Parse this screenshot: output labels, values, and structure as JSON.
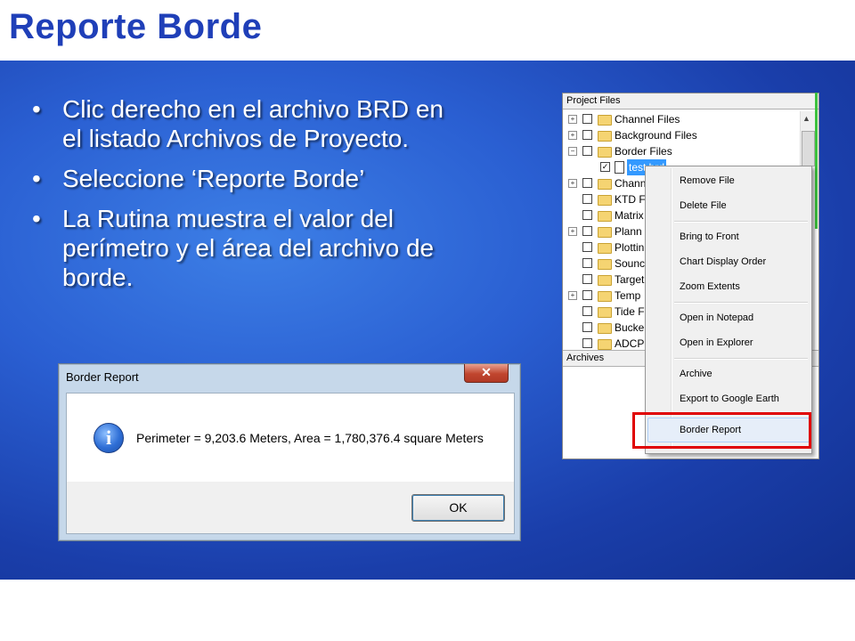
{
  "slide": {
    "title": "Reporte Borde",
    "bullets": [
      "Clic derecho en el archivo BRD en el listado Archivos de Proyecto.",
      "Seleccione  ‘Reporte Borde’",
      "La Rutina muestra el valor del perímetro y el área del archivo de borde."
    ]
  },
  "project_panel": {
    "header": "Project Files",
    "archives_header": "Archives",
    "tree": [
      {
        "label": "Channel Files",
        "icon": "folder-icon",
        "expander": "+"
      },
      {
        "label": "Background Files",
        "icon": "folder-icon",
        "expander": "+"
      },
      {
        "label": "Border Files",
        "icon": "folder-icon",
        "expander": "−"
      },
      {
        "label": "test.brd",
        "icon": "file-icon",
        "checked": true,
        "selected": true
      },
      {
        "label": "Channe",
        "icon": "folder-icon",
        "expander": "+"
      },
      {
        "label": "KTD F",
        "icon": "folder-icon"
      },
      {
        "label": "Matrix",
        "icon": "folder-icon"
      },
      {
        "label": "Plann",
        "icon": "folder-icon",
        "expander": "+"
      },
      {
        "label": "Plottin",
        "icon": "folder-icon"
      },
      {
        "label": "Sounc",
        "icon": "folder-icon"
      },
      {
        "label": "Target",
        "icon": "folder-icon"
      },
      {
        "label": "Temp",
        "icon": "folder-icon",
        "expander": "+"
      },
      {
        "label": "Tide F",
        "icon": "folder-icon"
      },
      {
        "label": "Bucke",
        "icon": "folder-icon"
      },
      {
        "label": "ADCP",
        "icon": "folder-icon"
      }
    ]
  },
  "context_menu": {
    "items": [
      "Remove File",
      "Delete File",
      "Bring to Front",
      "Chart Display Order",
      "Zoom Extents",
      "Open in Notepad",
      "Open in Explorer",
      "Archive",
      "Export to Google Earth",
      "Border Report"
    ],
    "highlighted": "Border Report"
  },
  "dialog": {
    "title": "Border Report",
    "close_glyph": "✕",
    "message": "Perimeter = 9,203.6 Meters,  Area = 1,780,376.4 square Meters",
    "info_glyph": "i",
    "ok_label": "OK"
  },
  "colors": {
    "title": "#1f3fb8",
    "slide_blue": "#2a5fd2",
    "highlight_border": "#e00000",
    "selection": "#3399ff"
  }
}
